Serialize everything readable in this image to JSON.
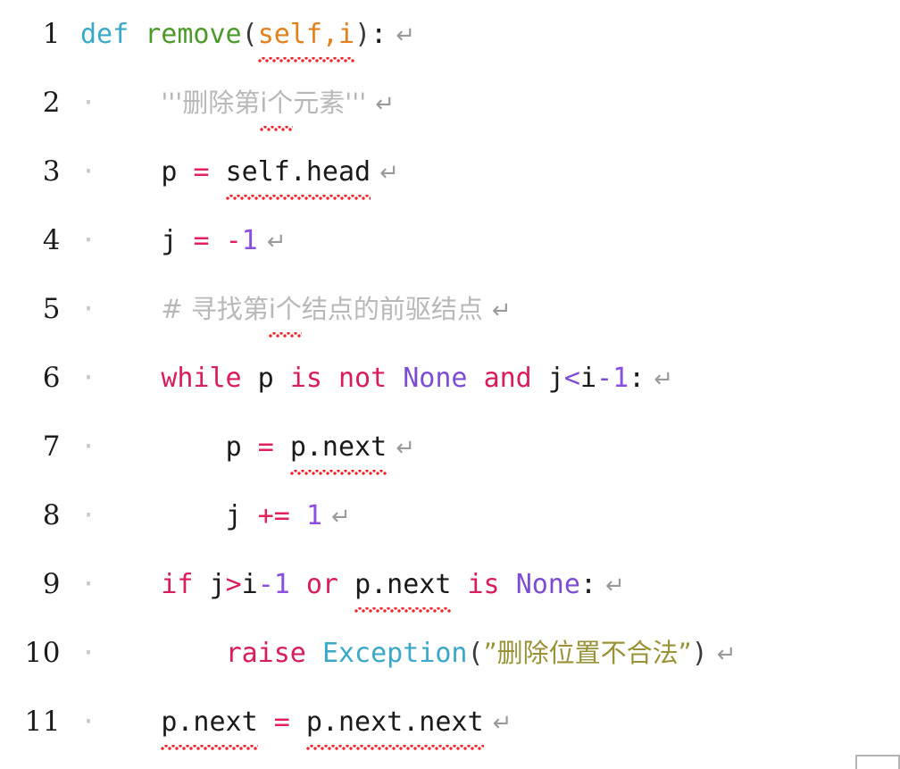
{
  "editor": {
    "background_color": "#ffffff",
    "language": "python",
    "total_lines": 11,
    "return_glyph": "↵",
    "whitespace_dot": "·",
    "colors": {
      "keyword": "#d81d5a",
      "def_keyword": "#3aa8c9",
      "function_name": "#4c9a2a",
      "parameter": "#e3801b",
      "builtin": "#3aa8c9",
      "constant": "#7c4dd4",
      "number": "#8a4fe0",
      "operator": "#e0215c",
      "string": "#9a9236",
      "comment": "#b8b8b8",
      "plain_text": "#1a1a1a",
      "line_number": "#1c1c1c",
      "squiggle": "#f0232a",
      "return_arrow": "#9a9a9a"
    }
  },
  "lines": [
    {
      "number": "1",
      "indent_dot": "",
      "plain": "def remove(self,i):",
      "tokens": [
        {
          "t": "def",
          "c": "tok-def",
          "squiggle": false
        },
        {
          "t": " ",
          "c": "tok-plain",
          "squiggle": false
        },
        {
          "t": "remove",
          "c": "tok-fn",
          "squiggle": false
        },
        {
          "t": "(",
          "c": "tok-punct",
          "squiggle": false
        },
        {
          "t": "self,i",
          "c": "tok-param",
          "squiggle": true
        },
        {
          "t": ")",
          "c": "tok-punct",
          "squiggle": false
        },
        {
          "t": ":",
          "c": "tok-plain",
          "squiggle": false
        }
      ]
    },
    {
      "number": "2",
      "indent_dot": "·",
      "plain": "'''删除第i个元素'''",
      "tokens": [
        {
          "t": "    ",
          "c": "tok-plain",
          "squiggle": false
        },
        {
          "t": "'''删除第",
          "c": "tok-comment",
          "squiggle": false,
          "cjk": true
        },
        {
          "t": "i个",
          "c": "tok-comment",
          "squiggle": true,
          "cjk": true
        },
        {
          "t": "元素'''",
          "c": "tok-comment",
          "squiggle": false,
          "cjk": true
        }
      ]
    },
    {
      "number": "3",
      "indent_dot": "·",
      "plain": "p = self.head",
      "tokens": [
        {
          "t": "    ",
          "c": "tok-plain",
          "squiggle": false
        },
        {
          "t": "p ",
          "c": "tok-plain",
          "squiggle": false
        },
        {
          "t": "=",
          "c": "tok-op",
          "squiggle": false
        },
        {
          "t": " ",
          "c": "tok-plain",
          "squiggle": false
        },
        {
          "t": "self.head",
          "c": "tok-plain",
          "squiggle": true
        }
      ]
    },
    {
      "number": "4",
      "indent_dot": "·",
      "plain": "j = -1",
      "tokens": [
        {
          "t": "    ",
          "c": "tok-plain",
          "squiggle": false
        },
        {
          "t": "j ",
          "c": "tok-plain",
          "squiggle": false
        },
        {
          "t": "=",
          "c": "tok-op",
          "squiggle": false
        },
        {
          "t": " ",
          "c": "tok-plain",
          "squiggle": false
        },
        {
          "t": "-",
          "c": "tok-op",
          "squiggle": false
        },
        {
          "t": "1",
          "c": "tok-num",
          "squiggle": false
        }
      ]
    },
    {
      "number": "5",
      "indent_dot": "·",
      "plain": "# 寻找第i个结点的前驱结点",
      "tokens": [
        {
          "t": "    ",
          "c": "tok-plain",
          "squiggle": false
        },
        {
          "t": "# 寻找第",
          "c": "tok-comment",
          "squiggle": false,
          "cjk": true
        },
        {
          "t": "i个",
          "c": "tok-comment",
          "squiggle": true,
          "cjk": true
        },
        {
          "t": "结点的前驱结点",
          "c": "tok-comment",
          "squiggle": false,
          "cjk": true
        }
      ]
    },
    {
      "number": "6",
      "indent_dot": "·",
      "plain": "while p is not None and j<i-1:",
      "tokens": [
        {
          "t": "    ",
          "c": "tok-plain",
          "squiggle": false
        },
        {
          "t": "while",
          "c": "tok-kw",
          "squiggle": false
        },
        {
          "t": " p ",
          "c": "tok-plain",
          "squiggle": false
        },
        {
          "t": "is not",
          "c": "tok-kw",
          "squiggle": false
        },
        {
          "t": " ",
          "c": "tok-plain",
          "squiggle": false
        },
        {
          "t": "None",
          "c": "tok-const",
          "squiggle": false
        },
        {
          "t": " ",
          "c": "tok-plain",
          "squiggle": false
        },
        {
          "t": "and",
          "c": "tok-kw",
          "squiggle": false
        },
        {
          "t": " j",
          "c": "tok-plain",
          "squiggle": false
        },
        {
          "t": "<",
          "c": "tok-opp",
          "squiggle": false
        },
        {
          "t": "i",
          "c": "tok-plain",
          "squiggle": false
        },
        {
          "t": "-",
          "c": "tok-opp",
          "squiggle": false
        },
        {
          "t": "1",
          "c": "tok-num",
          "squiggle": false
        },
        {
          "t": ":",
          "c": "tok-plain",
          "squiggle": false
        }
      ]
    },
    {
      "number": "7",
      "indent_dot": "·",
      "plain": "p = p.next",
      "tokens": [
        {
          "t": "        ",
          "c": "tok-plain",
          "squiggle": false
        },
        {
          "t": "p ",
          "c": "tok-plain",
          "squiggle": false
        },
        {
          "t": "=",
          "c": "tok-op",
          "squiggle": false
        },
        {
          "t": " ",
          "c": "tok-plain",
          "squiggle": false
        },
        {
          "t": "p.next",
          "c": "tok-plain",
          "squiggle": true
        }
      ]
    },
    {
      "number": "8",
      "indent_dot": "·",
      "plain": "j += 1",
      "tokens": [
        {
          "t": "        ",
          "c": "tok-plain",
          "squiggle": false
        },
        {
          "t": "j ",
          "c": "tok-plain",
          "squiggle": false
        },
        {
          "t": "+=",
          "c": "tok-op",
          "squiggle": false
        },
        {
          "t": " ",
          "c": "tok-plain",
          "squiggle": false
        },
        {
          "t": "1",
          "c": "tok-num",
          "squiggle": false
        }
      ]
    },
    {
      "number": "9",
      "indent_dot": "·",
      "plain": "if j>i-1 or p.next is None:",
      "tokens": [
        {
          "t": "    ",
          "c": "tok-plain",
          "squiggle": false
        },
        {
          "t": "if",
          "c": "tok-kw",
          "squiggle": false
        },
        {
          "t": " j",
          "c": "tok-plain",
          "squiggle": false
        },
        {
          "t": ">",
          "c": "tok-opr",
          "squiggle": false
        },
        {
          "t": "i",
          "c": "tok-plain",
          "squiggle": false
        },
        {
          "t": "-1",
          "c": "tok-num",
          "squiggle": false
        },
        {
          "t": " ",
          "c": "tok-plain",
          "squiggle": false
        },
        {
          "t": "or",
          "c": "tok-kw",
          "squiggle": false
        },
        {
          "t": " ",
          "c": "tok-plain",
          "squiggle": false
        },
        {
          "t": "p.next",
          "c": "tok-plain",
          "squiggle": true
        },
        {
          "t": " ",
          "c": "tok-plain",
          "squiggle": false
        },
        {
          "t": "is",
          "c": "tok-kw",
          "squiggle": false
        },
        {
          "t": " ",
          "c": "tok-plain",
          "squiggle": false
        },
        {
          "t": "None",
          "c": "tok-const",
          "squiggle": false
        },
        {
          "t": ":",
          "c": "tok-plain",
          "squiggle": false
        }
      ]
    },
    {
      "number": "10",
      "indent_dot": "·",
      "plain": "raise Exception(\"删除位置不合法\")",
      "tokens": [
        {
          "t": "        ",
          "c": "tok-plain",
          "squiggle": false
        },
        {
          "t": "raise",
          "c": "tok-kw",
          "squiggle": false
        },
        {
          "t": " ",
          "c": "tok-plain",
          "squiggle": false
        },
        {
          "t": "Exception",
          "c": "tok-builtin",
          "squiggle": false
        },
        {
          "t": "(",
          "c": "tok-punct",
          "squiggle": false
        },
        {
          "t": "”删除位置不合法”",
          "c": "tok-str",
          "squiggle": false,
          "cjk": true
        },
        {
          "t": ")",
          "c": "tok-punct",
          "squiggle": false
        }
      ]
    },
    {
      "number": "11",
      "indent_dot": "·",
      "plain": "p.next = p.next.next",
      "tokens": [
        {
          "t": "    ",
          "c": "tok-plain",
          "squiggle": false
        },
        {
          "t": "p.next",
          "c": "tok-plain",
          "squiggle": true
        },
        {
          "t": " ",
          "c": "tok-plain",
          "squiggle": false
        },
        {
          "t": "=",
          "c": "tok-op",
          "squiggle": false
        },
        {
          "t": " ",
          "c": "tok-plain",
          "squiggle": false
        },
        {
          "t": "p.next.next",
          "c": "tok-plain",
          "squiggle": true
        }
      ]
    }
  ]
}
